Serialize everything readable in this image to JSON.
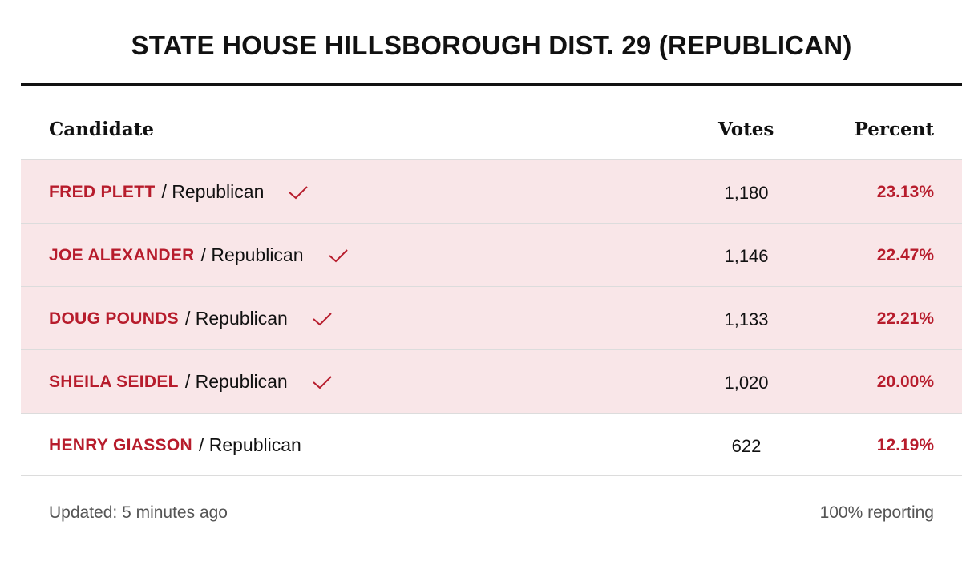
{
  "title": "STATE HOUSE HILLSBOROUGH DIST. 29 (REPUBLICAN)",
  "columns": {
    "candidate": "Candidate",
    "votes": "Votes",
    "percent": "Percent"
  },
  "accent_color": "#b71c2c",
  "winner_row_color": "#f9e6e8",
  "rows": [
    {
      "name": "FRED PLETT",
      "party": "/ Republican",
      "votes": "1,180",
      "percent": "23.13%",
      "winner": true,
      "icon": "checkmark-icon"
    },
    {
      "name": "JOE ALEXANDER",
      "party": "/ Republican",
      "votes": "1,146",
      "percent": "22.47%",
      "winner": true,
      "icon": "checkmark-icon"
    },
    {
      "name": "DOUG POUNDS",
      "party": "/ Republican",
      "votes": "1,133",
      "percent": "22.21%",
      "winner": true,
      "icon": "checkmark-icon"
    },
    {
      "name": "SHEILA SEIDEL",
      "party": "/ Republican",
      "votes": "1,020",
      "percent": "20.00%",
      "winner": true,
      "icon": "checkmark-icon"
    },
    {
      "name": "HENRY GIASSON",
      "party": "/ Republican",
      "votes": "622",
      "percent": "12.19%",
      "winner": false
    }
  ],
  "footer": {
    "updated": "Updated: 5 minutes ago",
    "reporting": "100% reporting"
  }
}
